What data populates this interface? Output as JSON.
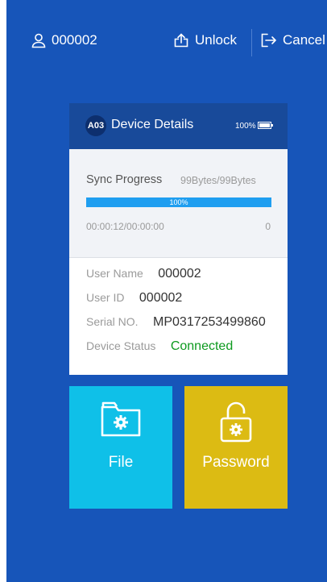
{
  "header": {
    "user_id": "000002",
    "unlock_label": "Unlock",
    "cancel_label": "Cancel"
  },
  "card": {
    "badge": "A03",
    "title": "Device Details",
    "battery_percent": "100%"
  },
  "sync": {
    "label": "Sync Progress",
    "bytes": "99Bytes/99Bytes",
    "progress": 100,
    "progress_text": "100%",
    "time": "00:00:12/00:00:00",
    "count": "0"
  },
  "info": {
    "user_name_label": "User Name",
    "user_name_value": "000002",
    "user_id_label": "User ID",
    "user_id_value": "000002",
    "serial_label": "Serial NO.",
    "serial_value": "MP0317253499860",
    "status_label": "Device Status",
    "status_value": "Connected"
  },
  "tiles": {
    "file_label": "File",
    "password_label": "Password"
  },
  "colors": {
    "background": "#1755b9",
    "header": "#184a9a",
    "progress": "#1f9ef0",
    "file_tile": "#0fc0e8",
    "password_tile": "#dcbb13",
    "status_connected": "#0d9a1f"
  },
  "icons": {
    "user": "user-icon",
    "unlock": "upload-icon",
    "cancel": "logout-icon",
    "battery": "battery-icon",
    "file": "folder-gear-icon",
    "password": "lock-gear-icon"
  }
}
